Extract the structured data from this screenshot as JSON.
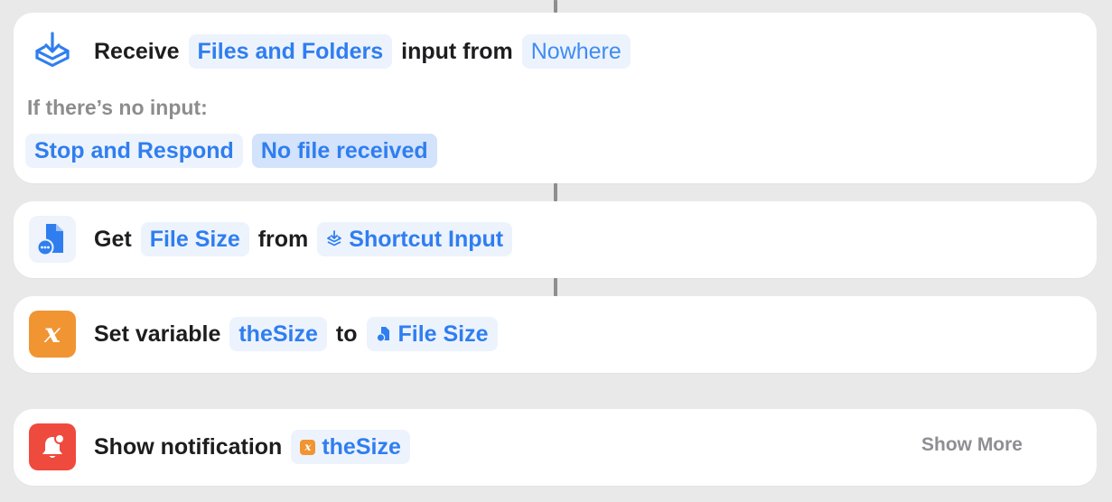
{
  "receive": {
    "verb": "Receive",
    "type": "Files and Folders",
    "connector": "input from",
    "source": "Nowhere",
    "no_input_label": "If there’s no input:",
    "action": "Stop and Respond",
    "response": "No file received"
  },
  "get": {
    "verb": "Get",
    "property": "File Size",
    "connector": "from",
    "source": "Shortcut Input"
  },
  "set_var": {
    "verb": "Set variable",
    "name": "theSize",
    "connector": "to",
    "value": "File Size",
    "icon_glyph": "x"
  },
  "notify": {
    "verb": "Show notification",
    "variable": "theSize",
    "show_more": "Show More",
    "icon_glyph": "x"
  },
  "colors": {
    "accent_blue": "#2f7ef0",
    "pill_bg": "#edf3fd",
    "var_orange": "#f19432",
    "notify_red": "#ef4a3e"
  },
  "icons": [
    "receive-input-icon",
    "file-doc-icon",
    "variable-icon",
    "notification-bell-icon"
  ]
}
